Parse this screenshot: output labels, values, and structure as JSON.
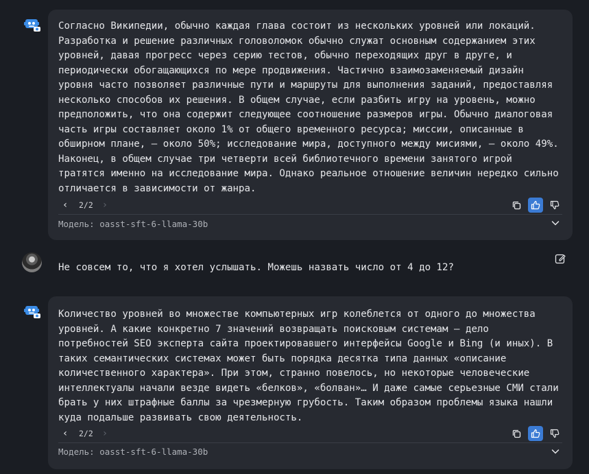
{
  "messages": [
    {
      "role": "assistant",
      "text": "Согласно Википедии, обычно каждая глава состоит из нескольких уровней или локаций. Разработка и решение различных головоломок обычно служат основным содержанием этих уровней, давая прогресс через серию тестов, обычно переходящих друг в друге, и периодически обогащающихся по мере продвижения. Частично взаимозаменяемый дизайн уровня часто позволяет различные пути и маршруты для выполнения заданий, предоставляя несколько способов их решения. В общем случае, если разбить игру на уровень, можно предположить, что она содержит следующее соотношение размеров игры. Обычно диалоговая часть игры составляет около 1% от общего временного ресурса; миссии, описанные в обширном плане, — около 50%; исследование мира, доступного между мисиями, — около 49%. Наконец, в общем случае три четверти всей библиотечного времени занятого игрой тратятся именно на исследование мира. Однако реальное отношение величин нередко сильно отличается в зависимости от жанра.",
      "pager": "2/2",
      "model_label": "Модель: oasst-sft-6-llama-30b"
    },
    {
      "role": "user",
      "text": "Не совсем то, что я хотел услышать. Можешь назвать число от 4 до 12?"
    },
    {
      "role": "assistant",
      "text": "Количество уровней во множестве компьютерных игр колеблется от одного до множества уровней. А какие конкретно 7 значений возвращать поисковым системам — дело потребностей SEO эксперта сайта проектировавшего интерфейсы Google и Bing (и иных). В таких семантических системах может быть порядка десятка типа данных «описание количественного характера». При этом, странно повелось, но некоторые человеческие интеллектуалы начали везде видеть «белков», «болван»… И даже самые серьезные СМИ стали брать у них штрафные баллы за чрезмерную грубость. Таким образом проблемы языка нашли куда подальше развивать свою деятельность.",
      "pager": "2/2",
      "model_label": "Модель: oasst-sft-6-llama-30b"
    }
  ],
  "colors": {
    "background": "#1a1d23",
    "bubble": "#272a31",
    "accent": "#3b7bd4",
    "bot_icon": "#3b8ce6"
  },
  "icons": [
    "robot-icon",
    "chevron-left-icon",
    "chevron-right-icon",
    "copy-icon",
    "thumbs-up-icon",
    "thumbs-down-icon",
    "chevron-down-icon",
    "edit-icon"
  ]
}
